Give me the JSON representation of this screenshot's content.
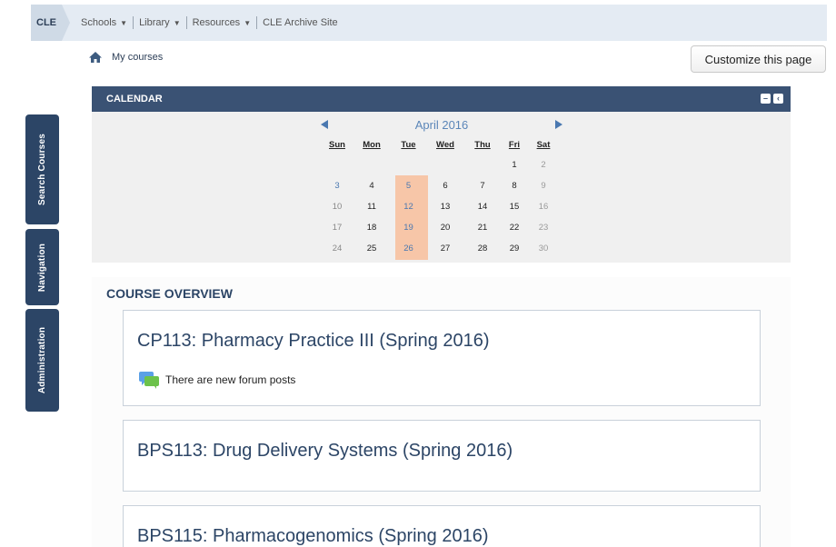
{
  "topnav": {
    "brand": "CLE",
    "menu": [
      {
        "label": "Schools",
        "dropdown": true
      },
      {
        "label": "Library",
        "dropdown": true
      },
      {
        "label": "Resources",
        "dropdown": true
      },
      {
        "label": "CLE Archive Site",
        "dropdown": false
      }
    ]
  },
  "breadcrumb": {
    "icon": "home-icon",
    "label": "My courses"
  },
  "customize_button": "Customize this page",
  "side_tabs": [
    "Search Courses",
    "Navigation",
    "Administration"
  ],
  "calendar": {
    "header": "CALENDAR",
    "month": "April 2016",
    "weekdays": [
      "Sun",
      "Mon",
      "Tue",
      "Wed",
      "Thu",
      "Fri",
      "Sat"
    ],
    "weeks": [
      [
        "",
        "",
        "",
        "",
        "",
        "1",
        "2"
      ],
      [
        "3",
        "4",
        "5",
        "6",
        "7",
        "8",
        "9"
      ],
      [
        "10",
        "11",
        "12",
        "13",
        "14",
        "15",
        "16"
      ],
      [
        "17",
        "18",
        "19",
        "20",
        "21",
        "22",
        "23"
      ],
      [
        "24",
        "25",
        "26",
        "27",
        "28",
        "29",
        "30"
      ]
    ],
    "highlight_color": "#f7c6a8"
  },
  "overview": {
    "title": "COURSE OVERVIEW",
    "courses": [
      {
        "name": "CP113: Pharmacy Practice III (Spring 2016)",
        "notice": "There are new forum posts"
      },
      {
        "name": "BPS113: Drug Delivery Systems (Spring 2016)",
        "notice": ""
      },
      {
        "name": "BPS115: Pharmacogenomics (Spring 2016)",
        "notice": ""
      }
    ]
  },
  "colors": {
    "accent": "#2c4566",
    "nav_bg": "#e4ebf3",
    "calendar_header": "#3a5274"
  }
}
